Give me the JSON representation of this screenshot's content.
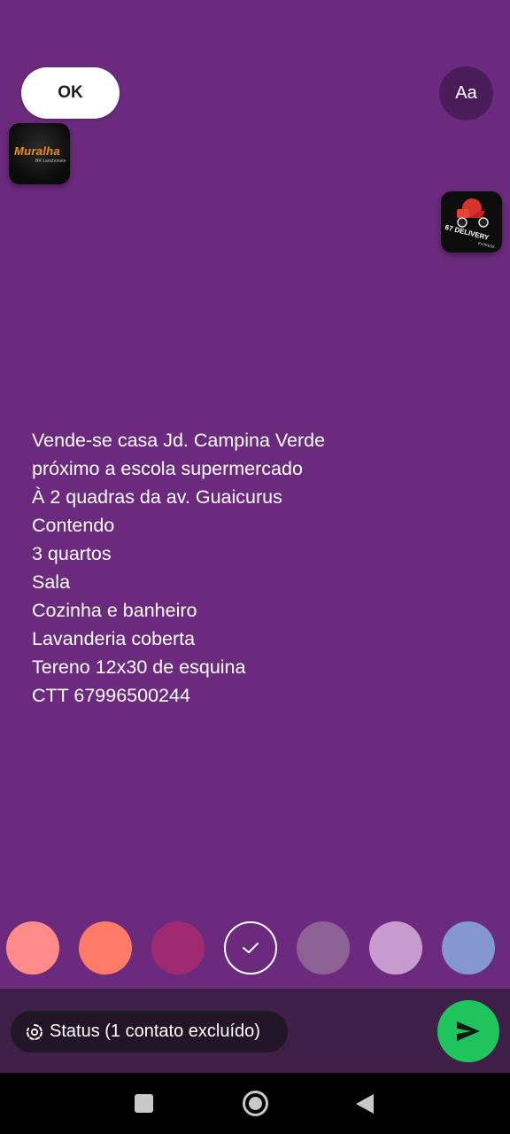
{
  "toolbar": {
    "ok_label": "OK",
    "font_label": "Aa"
  },
  "stickers": [
    {
      "name": "Muralha",
      "text": "Muralha",
      "subtext": "BR Lanchonete"
    },
    {
      "name": "67 Delivery",
      "text": "67 DELIVERY",
      "subtext": "EXPRESS"
    }
  ],
  "message": {
    "lines": [
      "Vende-se casa Jd. Campina Verde",
      "próximo a escola supermercado",
      "À 2 quadras da av. Guaicurus",
      "Contendo",
      "3 quartos",
      "Sala",
      "Cozinha e banheiro",
      "Lavanderia coberta",
      "Tereno 12x30 de esquina",
      "CTT 67996500244"
    ]
  },
  "background_color": "#6b2a7d",
  "swatches": [
    {
      "color": "#ff8a8a",
      "selected": false
    },
    {
      "color": "#ff7b68",
      "selected": false
    },
    {
      "color": "#a02a72",
      "selected": false
    },
    {
      "color": "#6b2a7d",
      "selected": true
    },
    {
      "color": "#8b6196",
      "selected": false
    },
    {
      "color": "#c79bd0",
      "selected": false
    },
    {
      "color": "#8497cf",
      "selected": false
    }
  ],
  "bottom": {
    "status_label": "Status (1 contato excluído)",
    "status_icon": "status-ring-icon",
    "send_icon": "send-arrow-icon",
    "send_color": "#1fc45c"
  },
  "navigation": {
    "recents_icon": "square-icon",
    "home_icon": "circle-home-icon",
    "back_icon": "triangle-back-icon"
  }
}
